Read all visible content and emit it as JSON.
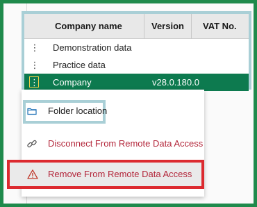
{
  "table": {
    "headers": {
      "company_name": "Company name",
      "version": "Version",
      "vat_no": "VAT No."
    },
    "rows": [
      {
        "name": "Demonstration data",
        "version": "",
        "vat": ""
      },
      {
        "name": "Practice data",
        "version": "",
        "vat": ""
      },
      {
        "name": "Company",
        "version": "v28.0.180.0",
        "vat": "",
        "selected": true
      }
    ],
    "row_menu_glyph": "⋮"
  },
  "context_menu": {
    "folder_location": "Folder location",
    "disconnect": "Disconnect From Remote Data Access",
    "remove": "Remove From Remote Data Access"
  },
  "icons": {
    "folder": "folder-icon",
    "disconnect": "broken-link-icon",
    "remove": "warning-triangle-icon"
  },
  "colors": {
    "selection": "#0d7a4f",
    "highlight_outline": "#a9cfd6",
    "danger_outline": "#dc2a2f",
    "danger_text": "#b3263a"
  }
}
